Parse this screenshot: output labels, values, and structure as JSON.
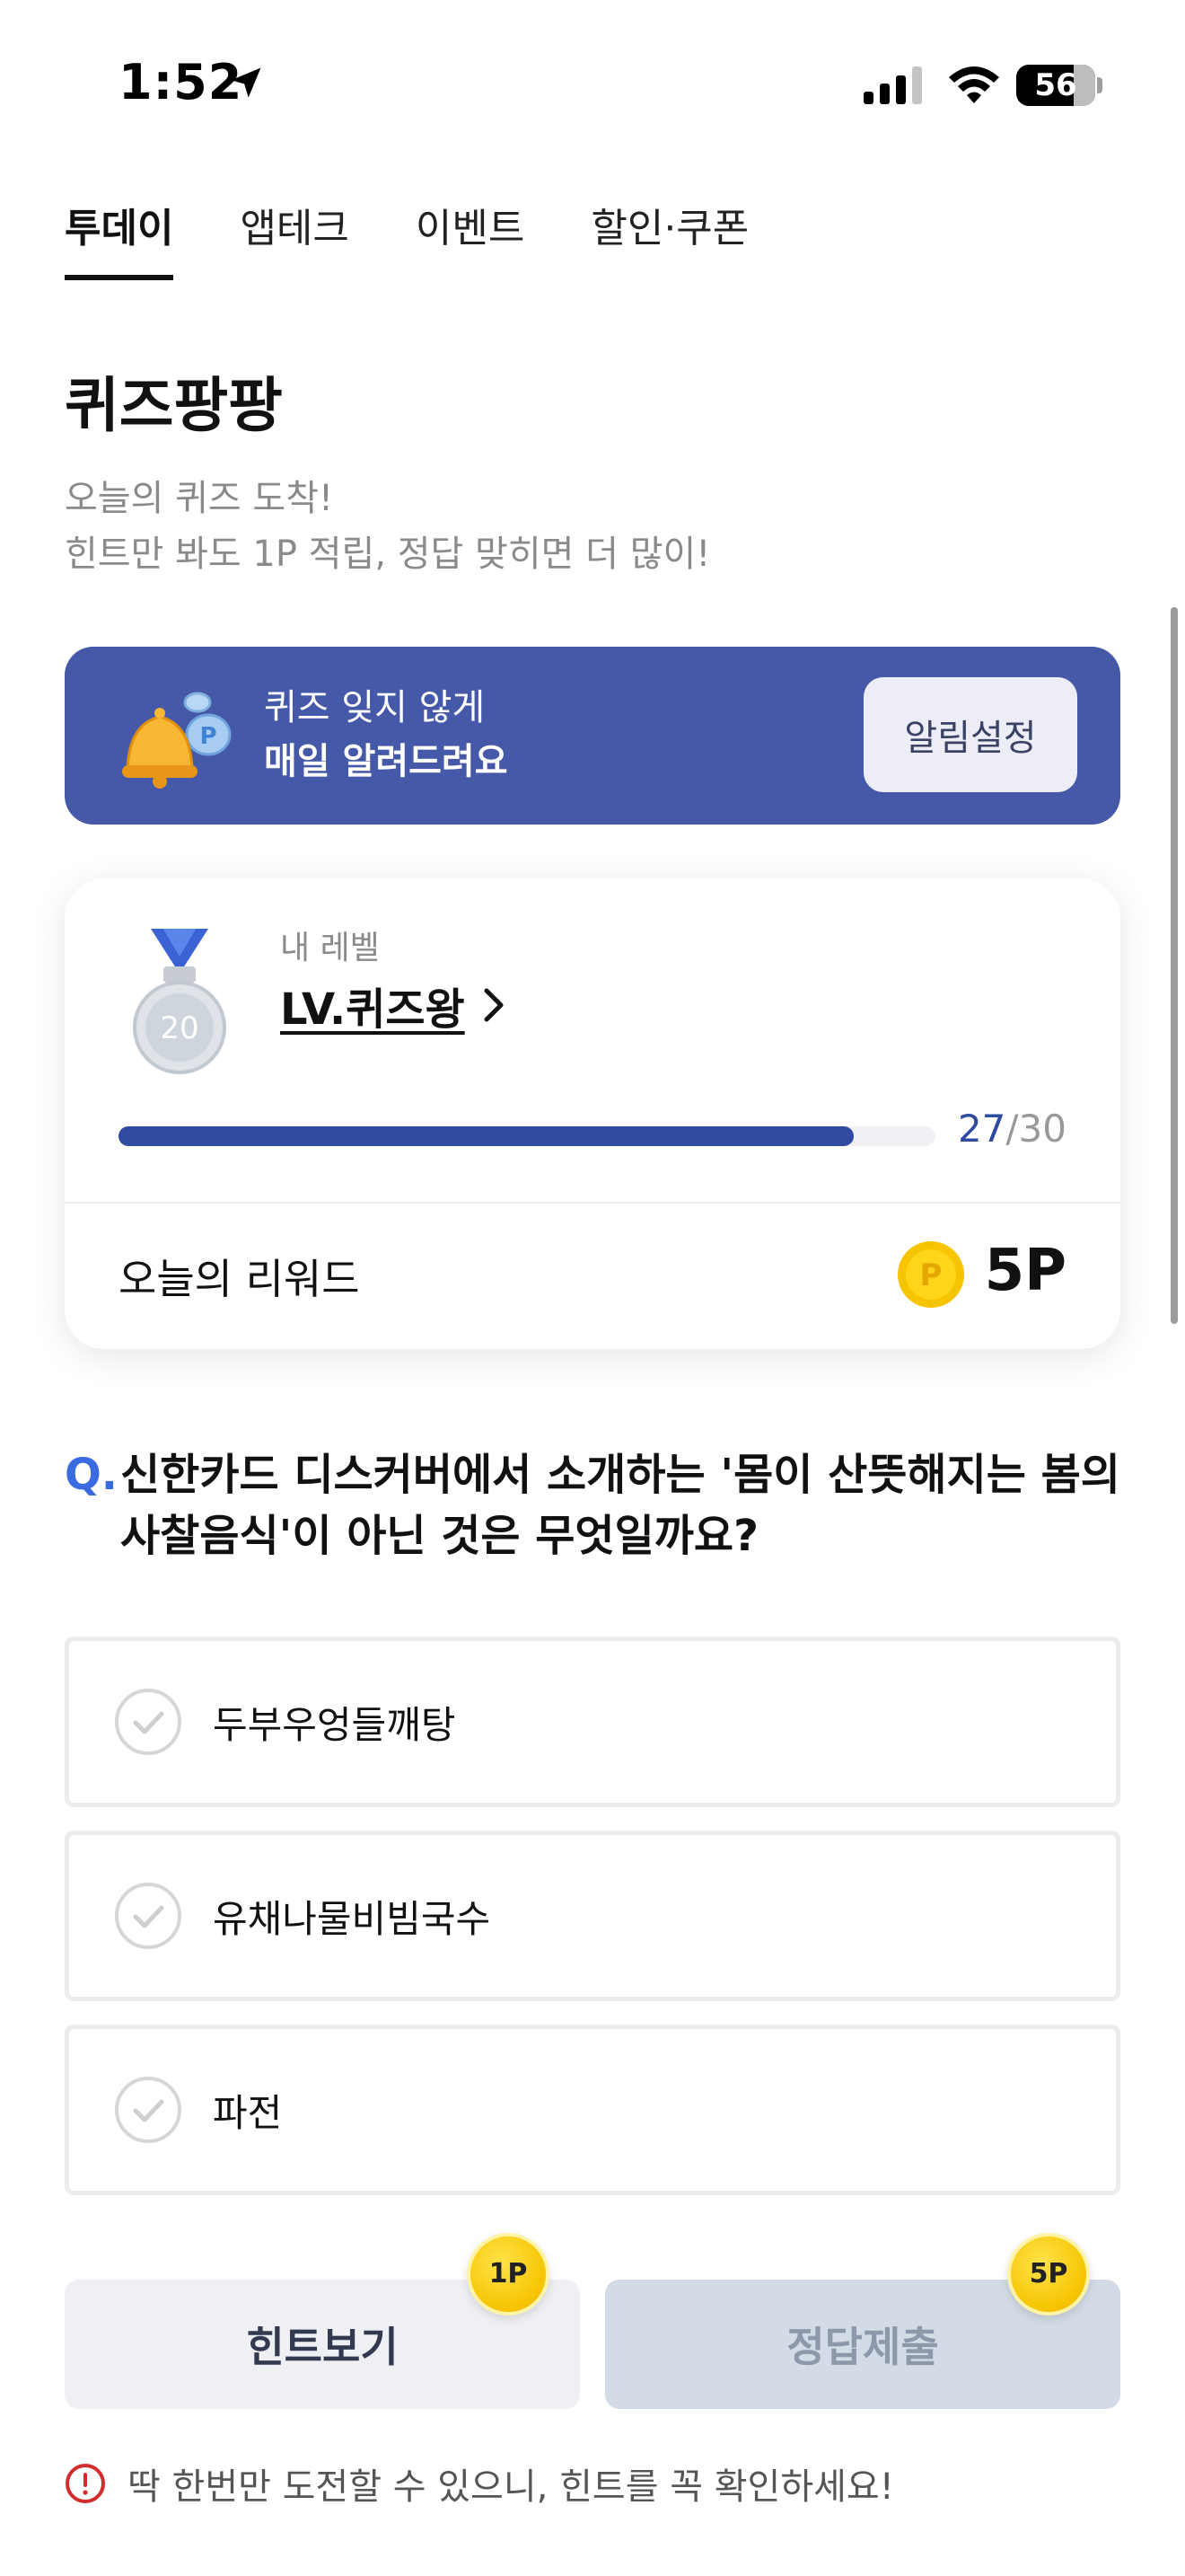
{
  "status_bar": {
    "time": "1:52",
    "battery_level": "56"
  },
  "tabs": [
    {
      "label": "투데이",
      "active": true
    },
    {
      "label": "앱테크",
      "active": false
    },
    {
      "label": "이벤트",
      "active": false
    },
    {
      "label": "할인·쿠폰",
      "active": false
    }
  ],
  "header": {
    "title": "퀴즈팡팡",
    "subtitle_line1": "오늘의 퀴즈 도착!",
    "subtitle_line2": "힌트만 봐도 1P 적립, 정답 맞히면 더 많이!"
  },
  "banner": {
    "line1": "퀴즈 잊지 않게",
    "line2": "매일 알려드려요",
    "button_label": "알림설정"
  },
  "level_card": {
    "label": "내 레벨",
    "level_name": "LV.퀴즈왕",
    "medal_number": "20",
    "progress_current": "27",
    "progress_separator": "/",
    "progress_total": "30",
    "progress_fraction": 0.9,
    "reward_label": "오늘의 리워드",
    "reward_value": "5P",
    "coin_letter": "P"
  },
  "question": {
    "marker": "Q.",
    "text": "신한카드 디스커버에서 소개하는 '몸이 산뜻해지는 봄의 사찰음식'이 아닌 것은 무엇일까요?"
  },
  "options": [
    {
      "label": "두부우엉들깨탕"
    },
    {
      "label": "유채나물비빔국수"
    },
    {
      "label": "파전"
    }
  ],
  "actions": {
    "hint_label": "힌트보기",
    "hint_points": "1P",
    "submit_label": "정답제출",
    "submit_points": "5P"
  },
  "notice": {
    "text": "딱 한번만 도전할 수 있으니, 힌트를 꼭 확인하세요!"
  },
  "colors": {
    "banner_bg": "#4659a8",
    "progress_fill": "#2f4aa1",
    "question_marker": "#3b6be0",
    "coin": "#f6c400",
    "warning": "#d22c2c"
  }
}
